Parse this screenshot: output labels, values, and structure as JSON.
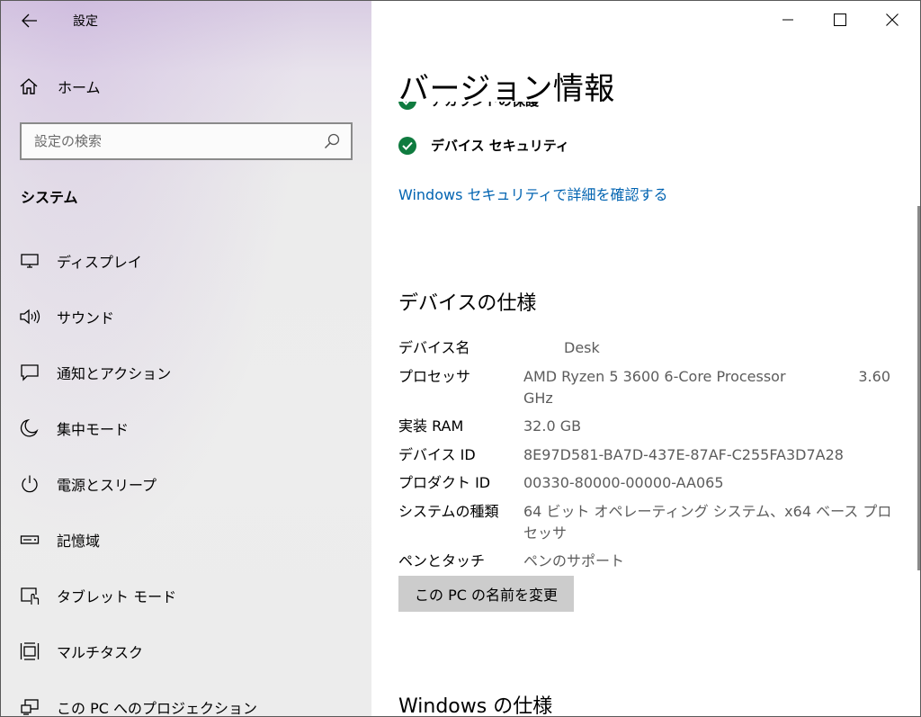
{
  "app": {
    "title": "設定"
  },
  "sidebar": {
    "home_label": "ホーム",
    "search_placeholder": "設定の検索",
    "section_title": "システム",
    "items": [
      {
        "label": "ディスプレイ",
        "icon": "display-icon"
      },
      {
        "label": "サウンド",
        "icon": "speaker-icon"
      },
      {
        "label": "通知とアクション",
        "icon": "notification-icon"
      },
      {
        "label": "集中モード",
        "icon": "moon-icon"
      },
      {
        "label": "電源とスリープ",
        "icon": "power-icon"
      },
      {
        "label": "記憶域",
        "icon": "storage-icon"
      },
      {
        "label": "タブレット モード",
        "icon": "tablet-icon"
      },
      {
        "label": "マルチタスク",
        "icon": "multitask-icon"
      },
      {
        "label": "この PC へのプロジェクション",
        "icon": "projection-icon"
      }
    ]
  },
  "main": {
    "page_title": "バージョン情報",
    "clipped_status": "アカウントの保護",
    "status_item": "デバイス セキュリティ",
    "security_link": "Windows セキュリティで詳細を確認する",
    "device_specs_title": "デバイスの仕様",
    "specs": {
      "device_name": {
        "label": "デバイス名",
        "value": "Desk"
      },
      "processor": {
        "label": "プロセッサ",
        "value": "AMD Ryzen 5 3600 6-Core Processor",
        "speed": "3.60",
        "unit": "GHz"
      },
      "ram": {
        "label": "実装 RAM",
        "value": "32.0 GB"
      },
      "device_id": {
        "label": "デバイス ID",
        "value": "8E97D581-BA7D-437E-87AF-C255FA3D7A28"
      },
      "product_id": {
        "label": "プロダクト ID",
        "value": "00330-80000-00000-AA065"
      },
      "system_type": {
        "label": "システムの種類",
        "value": "64 ビット オペレーティング システム、x64 ベース プロセッサ"
      },
      "pen_touch": {
        "label": "ペンとタッチ",
        "value": "ペンのサポート"
      }
    },
    "rename_button": "この PC の名前を変更",
    "windows_specs_title": "Windows の仕様"
  },
  "colors": {
    "accent_link": "#0063b1",
    "check_green": "#0f7b3f",
    "button_gray": "#cccccc"
  }
}
